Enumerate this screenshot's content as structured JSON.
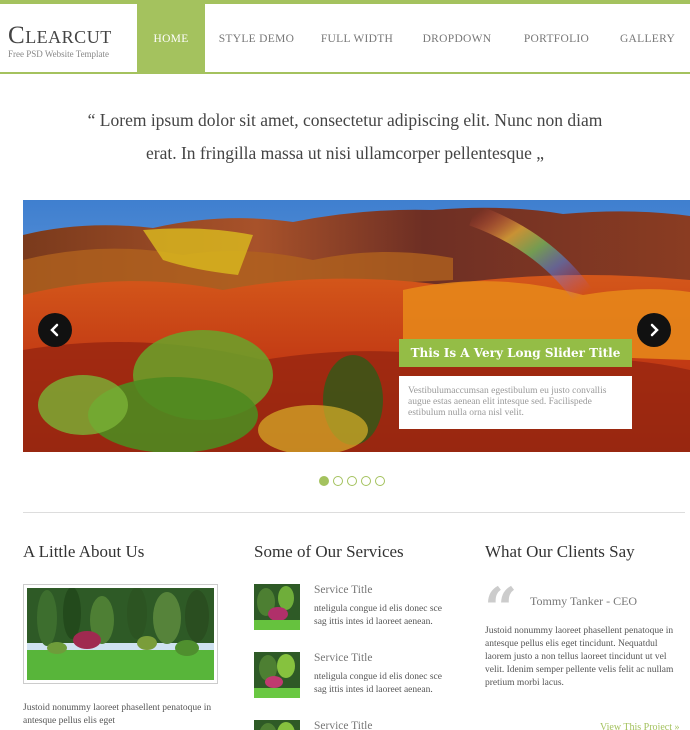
{
  "brand": {
    "name": "Clearcut",
    "tagline": "Free PSD Website Template",
    "accent": "#a4c25e"
  },
  "nav": {
    "items": [
      {
        "label": "HOME",
        "active": true
      },
      {
        "label": "STYLE DEMO",
        "active": false
      },
      {
        "label": "FULL WIDTH",
        "active": false
      },
      {
        "label": "DROPDOWN",
        "active": false
      },
      {
        "label": "PORTFOLIO",
        "active": false
      },
      {
        "label": "GALLERY",
        "active": false
      }
    ]
  },
  "intro_quote": {
    "line1": "“ Lorem ipsum dolor sit amet, consectetur adipiscing elit. Nunc non diam",
    "line2": "erat. In fringilla massa ut nisi ullamcorper pellentesque „"
  },
  "slider": {
    "title": "This Is A Very Long Slider Title",
    "caption": "Vestibulumaccumsan egestibulum eu justo convallis augue estas aenean elit intesque sed. Facilispede estibulum nulla orna nisl velit.",
    "prev_icon": "chevron-left-icon",
    "next_icon": "chevron-right-icon",
    "slide_count": 5,
    "active_slide": 1
  },
  "about": {
    "heading": "A Little About Us",
    "text": "Justoid nonummy laoreet phasellent penatoque in antesque pellus elis eget"
  },
  "services": {
    "heading": "Some of Our Services",
    "items": [
      {
        "title": "Service Title",
        "text": "nteligula congue id elis donec sce sag ittis intes id laoreet aenean."
      },
      {
        "title": "Service Title",
        "text": "nteligula congue id elis donec sce sag ittis intes id laoreet aenean."
      },
      {
        "title": "Service Title",
        "text": ""
      }
    ]
  },
  "testimonials": {
    "heading": "What Our Clients Say",
    "client_name": "Tommy Tanker - CEO",
    "text": "Justoid nonummy laoreet phasellent penatoque in antesque pellus elis eget tincidunt. Nequatdul laorem justo a non tellus laoreet tincidunt ut vel velit. Idenim semper pellente velis felit ac nullam pretium morbi lacus.",
    "link": "View This Project »",
    "quote_icon": "quote-icon"
  }
}
